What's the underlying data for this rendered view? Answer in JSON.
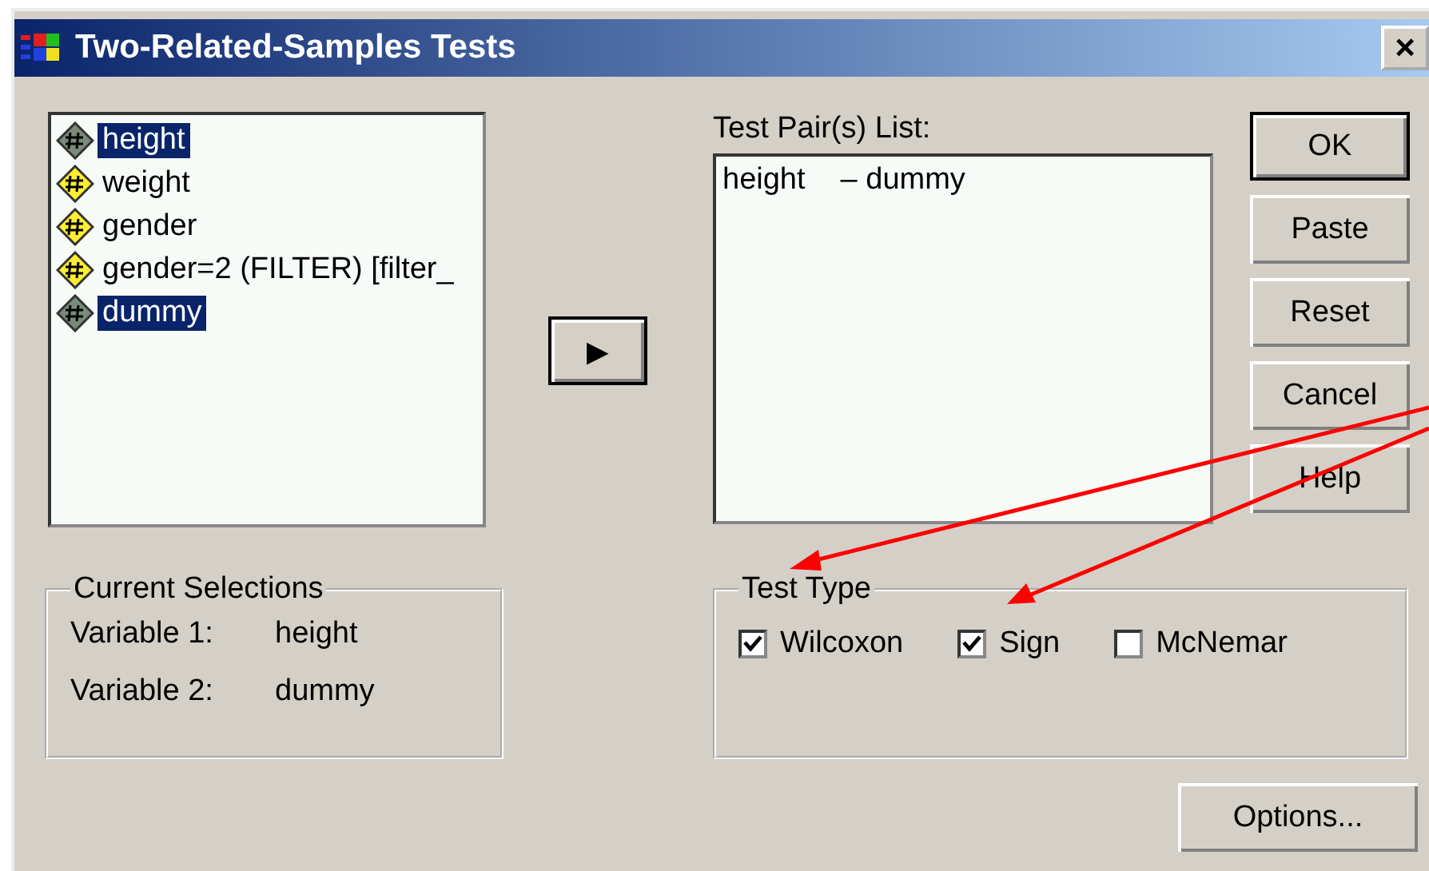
{
  "window": {
    "title": "Two-Related-Samples Tests",
    "close": "×"
  },
  "variables": [
    {
      "label": "height",
      "selected": true
    },
    {
      "label": "weight",
      "selected": false
    },
    {
      "label": "gender",
      "selected": false
    },
    {
      "label": "gender=2 (FILTER) [filter_",
      "selected": false
    },
    {
      "label": "dummy",
      "selected": true
    }
  ],
  "move_button": "▶",
  "pair_list": {
    "label": "Test Pair(s) List:",
    "pairs": [
      {
        "first": "height",
        "second": "– dummy"
      }
    ]
  },
  "buttons": [
    "OK",
    "Paste",
    "Reset",
    "Cancel",
    "Help"
  ],
  "current_selections": {
    "title": "Current Selections",
    "rows": [
      {
        "label": "Variable 1:",
        "value": "height"
      },
      {
        "label": "Variable 2:",
        "value": "dummy"
      }
    ]
  },
  "test_type": {
    "title": "Test Type",
    "options": [
      {
        "label": "Wilcoxon",
        "checked": true
      },
      {
        "label": "Sign",
        "checked": true
      },
      {
        "label": "McNemar",
        "checked": false
      }
    ]
  },
  "options_button": "Options..."
}
